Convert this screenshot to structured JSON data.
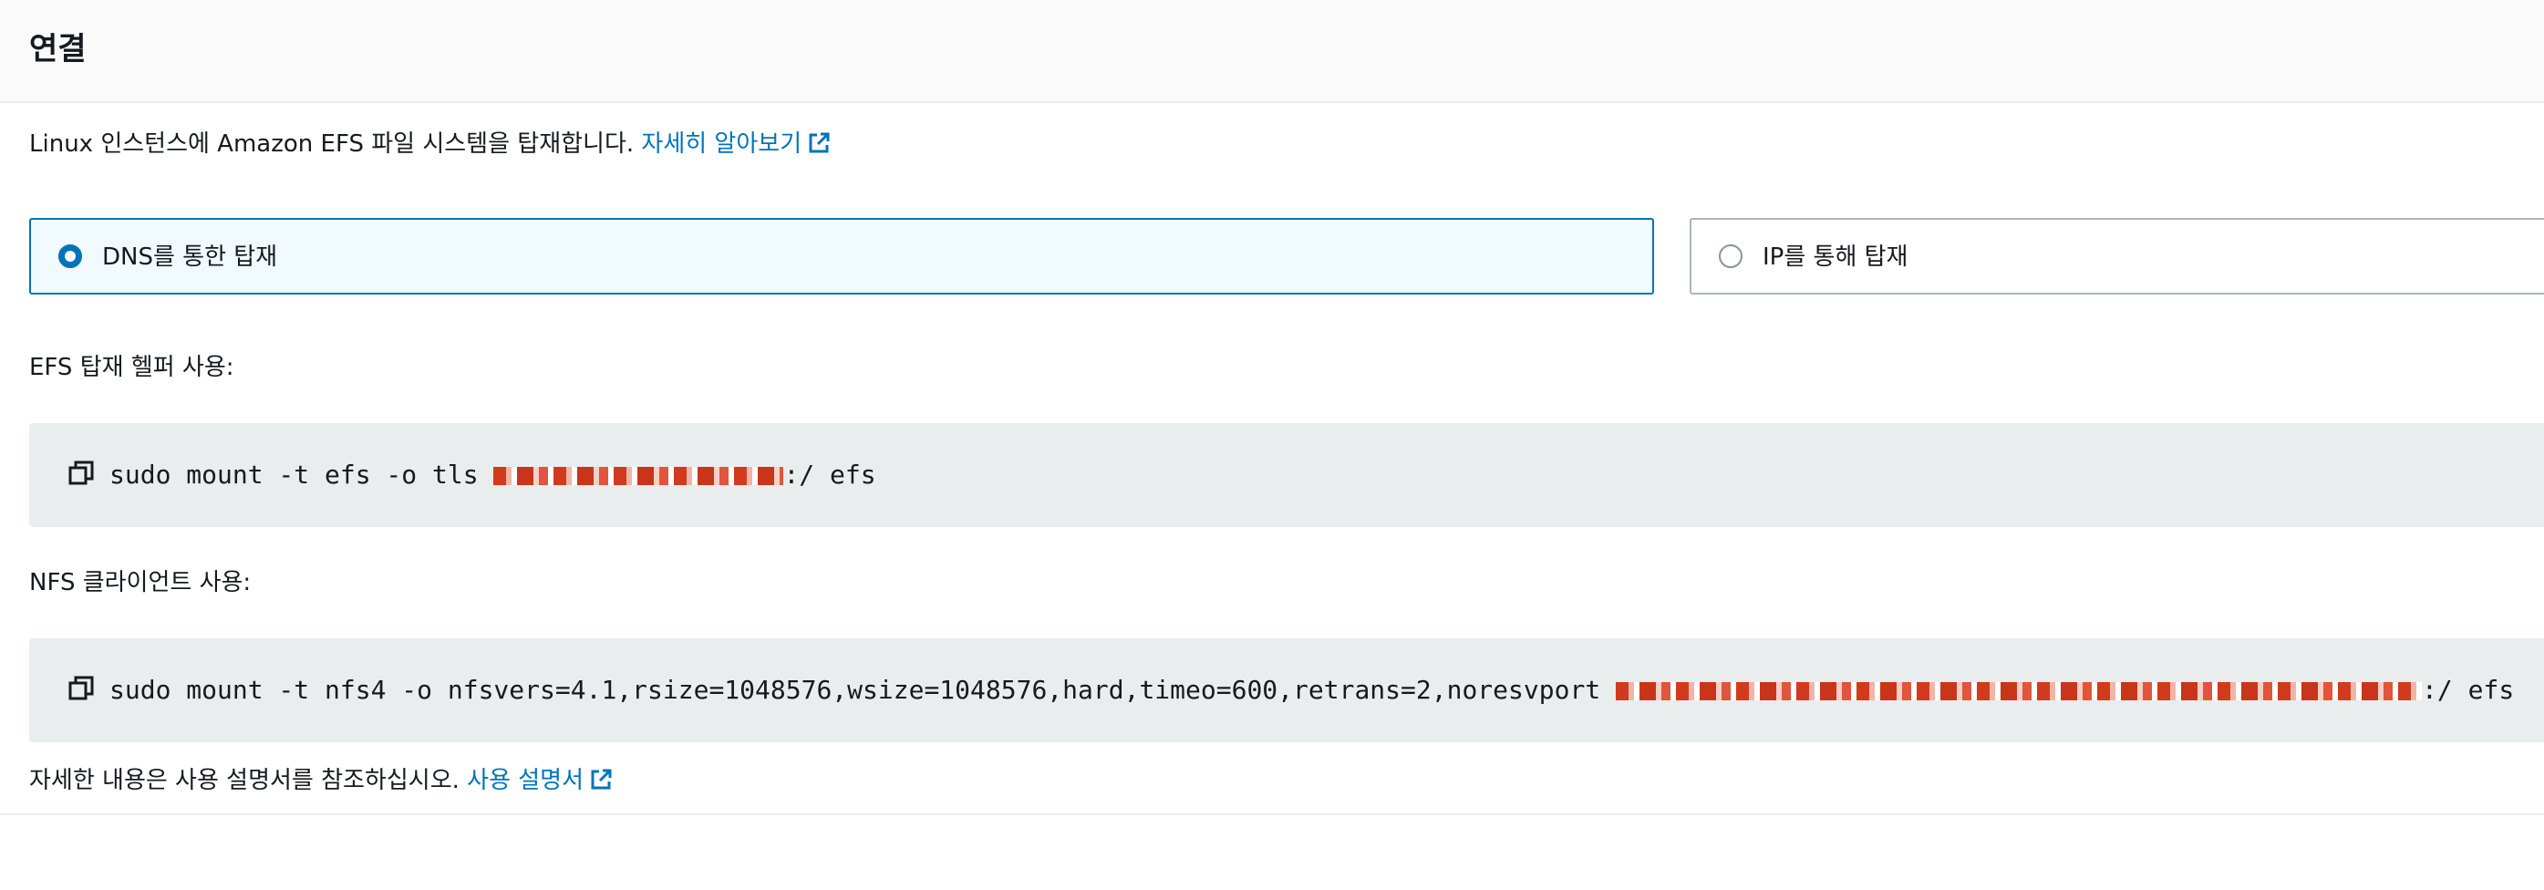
{
  "panel": {
    "title": "연결"
  },
  "intro": {
    "text": "Linux 인스턴스에 Amazon EFS 파일 시스템을 탑재합니다. ",
    "link": "자세히 알아보기"
  },
  "mount_options": [
    {
      "label": "DNS를 통한 탑재",
      "selected": true
    },
    {
      "label": "IP를 통해 탑재",
      "selected": false
    }
  ],
  "efs_helper": {
    "label": "EFS 탑재 헬퍼 사용:",
    "command_prefix": "sudo mount -t efs -o tls ",
    "command_suffix": ":/ efs"
  },
  "nfs_client": {
    "label": "NFS 클라이언트 사용:",
    "command_prefix": "sudo mount -t nfs4 -o nfsvers=4.1,rsize=1048576,wsize=1048576,hard,timeo=600,retrans=2,noresvport ",
    "command_suffix": ":/ efs"
  },
  "footer": {
    "text": "자세한 내용은 사용 설명서를 참조하십시오. ",
    "link": "사용 설명서"
  },
  "icons": {
    "external_link": "external-link-icon",
    "copy": "copy-icon"
  },
  "colors": {
    "accent": "#0073bb",
    "redaction": "#d23a1e",
    "code_bg": "#eaeded"
  }
}
